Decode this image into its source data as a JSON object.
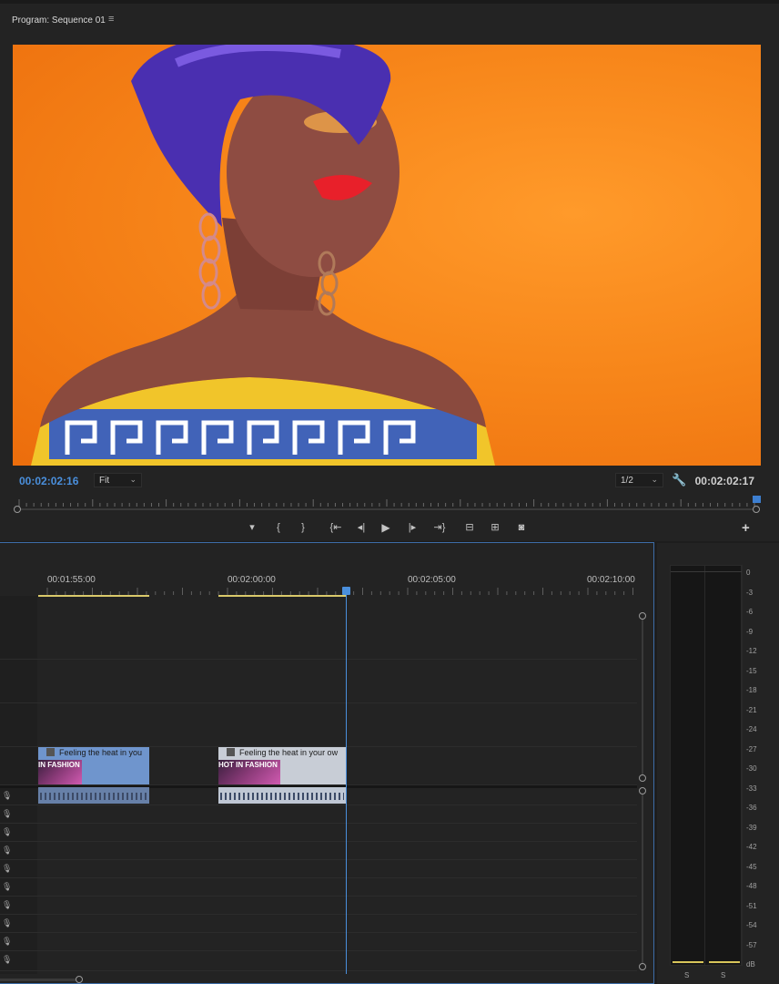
{
  "program": {
    "title": "Program: Sequence 01",
    "menu_icon": "≡",
    "current_timecode": "00:02:02:16",
    "duration_timecode": "00:02:02:17",
    "zoom": "Fit",
    "resolution": "1/2"
  },
  "transport": {
    "add_marker": "▾",
    "mark_in": "{",
    "mark_out": "}",
    "go_to_in": "{⇤",
    "step_back": "◂|",
    "play": "▶",
    "step_forward": "|▸",
    "go_to_out": "⇥}",
    "lift": "⊟",
    "extract": "⊞",
    "export_frame": "◙",
    "add": "+"
  },
  "timeline": {
    "ruler_labels": [
      "00:01:55:00",
      "00:02:00:00",
      "00:02:05:00",
      "00:02:10:00"
    ],
    "clips": [
      {
        "caption": "Feeling the heat in you",
        "thumb_text": "IN FASHION"
      },
      {
        "caption": "Feeling the heat in your ow",
        "thumb_text": "HOT IN FASHION"
      }
    ]
  },
  "meters": {
    "scale": [
      "0",
      "-3",
      "-6",
      "-9",
      "-12",
      "-15",
      "-18",
      "-21",
      "-24",
      "-27",
      "-30",
      "-33",
      "-36",
      "-39",
      "-42",
      "-45",
      "-48",
      "-51",
      "-54",
      "-57",
      "dB"
    ],
    "solo_left": "S",
    "solo_right": "S"
  },
  "colors": {
    "timecode_blue": "#4a8fdc",
    "playhead": "#4a8fdc",
    "video_clip": "#6f95cd",
    "video_clip_selected": "#c8cdd6",
    "work_area": "#d9c96a"
  }
}
